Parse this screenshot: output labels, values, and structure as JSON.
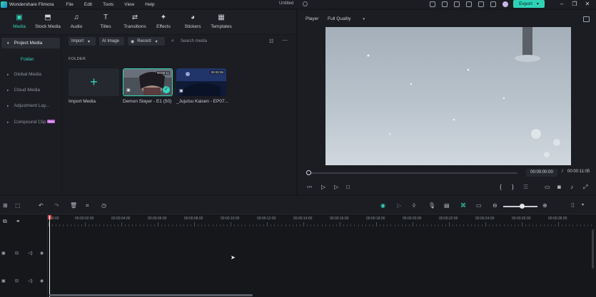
{
  "app": {
    "name": "Wondershare Filmora",
    "document_title": "Untitled"
  },
  "menu": [
    "File",
    "Edit",
    "Tools",
    "View",
    "Help"
  ],
  "export_label": "Export",
  "colors": {
    "accent": "#34d6bd",
    "export_bg": "#2ed3b7",
    "panel_bg": "#1b1d22",
    "app_bg": "#15171b",
    "beta": "#c063d8",
    "playhead": "#e84b4b"
  },
  "toolbar": {
    "tabs": [
      {
        "label": "Media",
        "icon": "media-icon",
        "glyph": "▣",
        "active": true
      },
      {
        "label": "Stock Media",
        "icon": "stock-media-icon",
        "glyph": "⬒",
        "active": false
      },
      {
        "label": "Audio",
        "icon": "audio-icon",
        "glyph": "♫",
        "active": false
      },
      {
        "label": "Titles",
        "icon": "titles-icon",
        "glyph": "T",
        "active": false
      },
      {
        "label": "Transitions",
        "icon": "transitions-icon",
        "glyph": "⇄",
        "active": false
      },
      {
        "label": "Effects",
        "icon": "effects-icon",
        "glyph": "✦",
        "active": false
      },
      {
        "label": "Stickers",
        "icon": "stickers-icon",
        "glyph": "◕",
        "active": false
      },
      {
        "label": "Templates",
        "icon": "templates-icon",
        "glyph": "▦",
        "active": false
      }
    ]
  },
  "sidebar": {
    "project_media": "Project Media",
    "folder": "Folder",
    "items": [
      "Global Media",
      "Cloud Media",
      "Adjustment Lay...",
      "Compound Clip"
    ],
    "compound_badge": "Beta"
  },
  "media": {
    "import_dropdown": "Import",
    "ai_image": "AI Image",
    "record_dropdown": "Record",
    "search_placeholder": "Search media",
    "folder_heading": "FOLDER",
    "import_tile_label": "Import Media",
    "clips": [
      {
        "name": "Demon Slayer - E1 (50)",
        "duration": "00:00:11",
        "selected": true
      },
      {
        "name": "_Jujutsu Kaisen - EP07...",
        "duration": "00:00:05",
        "selected": false
      }
    ]
  },
  "player": {
    "label": "Player",
    "quality": "Full Quality",
    "current_time": "00:00:00:00",
    "separator": "/",
    "total_time": "00:00:11:05",
    "progress": 0
  },
  "timeline": {
    "ruler_labels": [
      "00:00",
      "00:00:02:00",
      "00:00:04:00",
      "00:00:06:00",
      "00:00:08:00",
      "00:00:10:00",
      "00:00:12:00",
      "00:00:14:00",
      "00:00:16:00",
      "00:00:18:00",
      "00:00:20:00",
      "00:00:22:00",
      "00:00:24:00",
      "00:00:26:00",
      "00:00:28:00"
    ]
  }
}
